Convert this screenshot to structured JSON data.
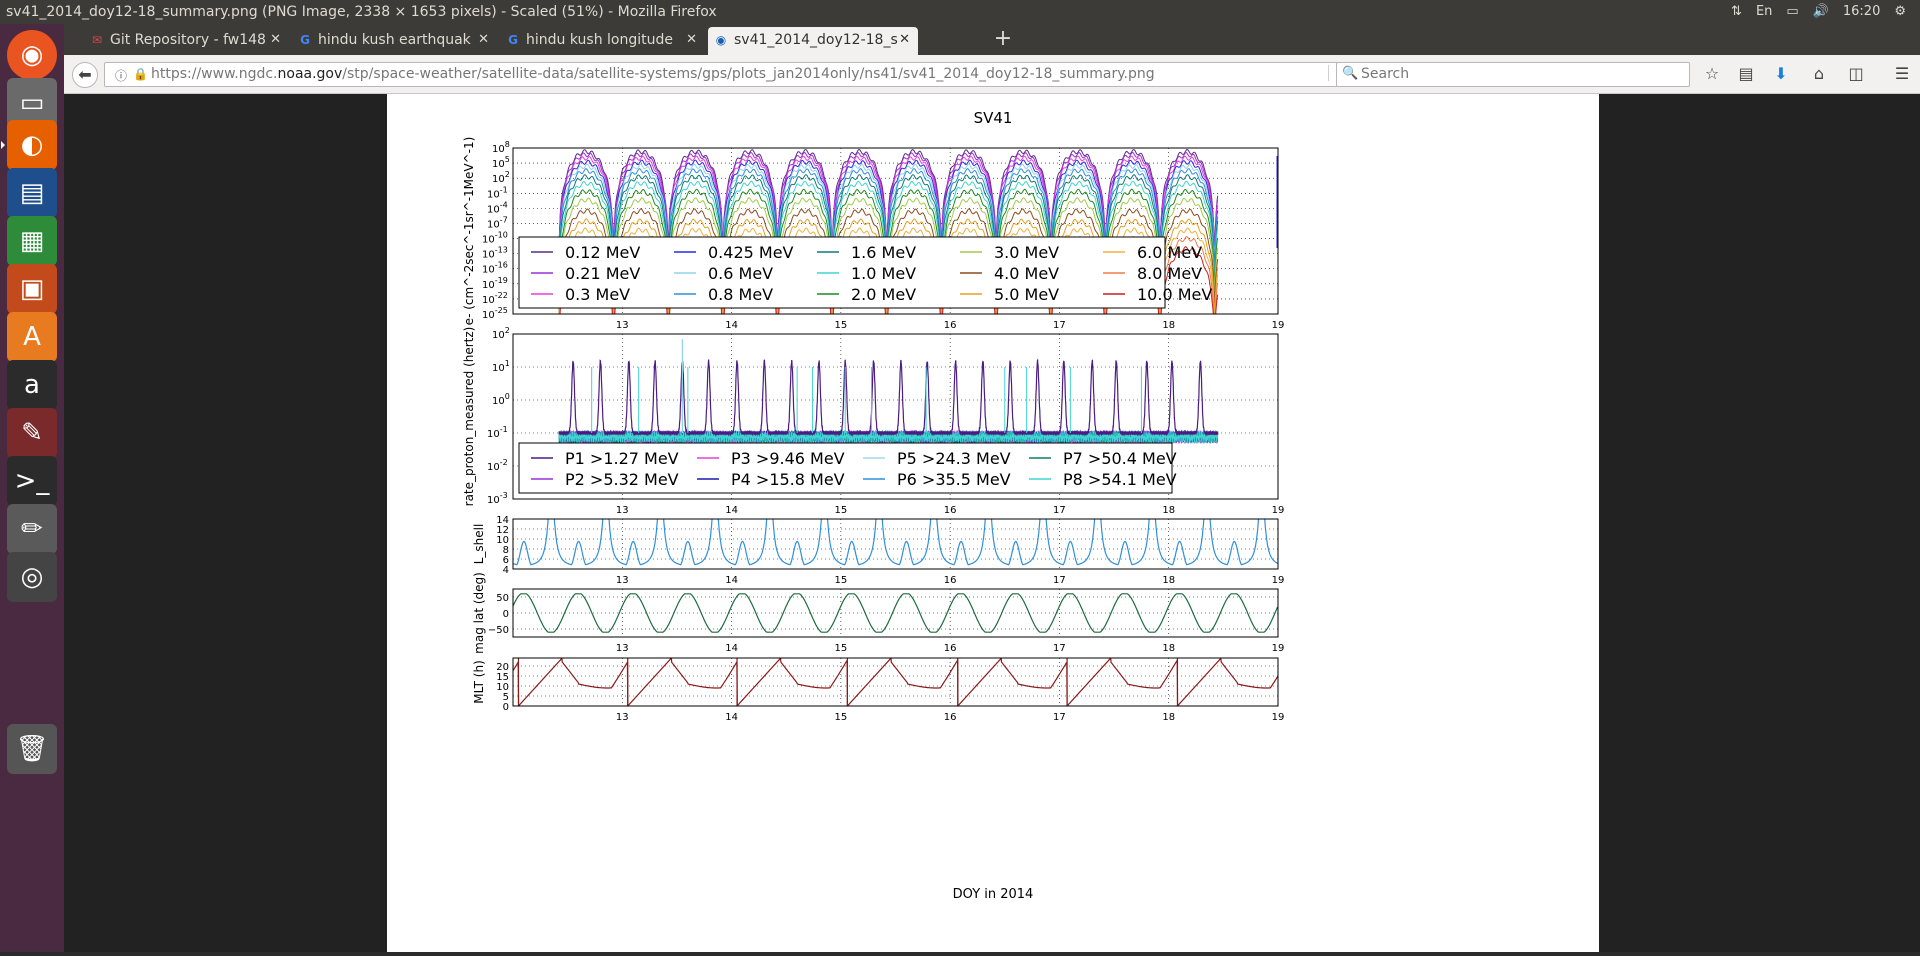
{
  "window": {
    "title": "sv41_2014_doy12-18_summary.png (PNG Image, 2338 × 1653 pixels) - Scaled (51%) - Mozilla Firefox",
    "tray_lang": "En",
    "clock": "16:20"
  },
  "tabs": [
    {
      "label": "Git Repository - fw148",
      "icon": "gmail-icon"
    },
    {
      "label": "hindu kush earthquak",
      "icon": "google-icon"
    },
    {
      "label": "hindu kush longitude",
      "icon": "google-icon"
    },
    {
      "label": "sv41_2014_doy12-18_s",
      "icon": "noaa-icon",
      "active": true
    }
  ],
  "navbar": {
    "url_prefix": "https://www.ngdc.",
    "url_domain": "noaa.gov",
    "url_path": "/stp/space-weather/satellite-data/satellite-systems/gps/plots_jan2014only/ns41/sv41_2014_doy12-18_summary.png",
    "search_placeholder": "Search"
  },
  "launcher": [
    "ubuntu-icon",
    "files-icon",
    "firefox-icon",
    "writer-icon",
    "calc-icon",
    "impress-icon",
    "software-center-icon",
    "amazon-icon",
    "settings-icon",
    "terminal-icon",
    "text-editor-icon",
    "dvd-icon",
    "trash-icon"
  ],
  "chart_data": {
    "title": "SV41",
    "xlabel": "DOY in 2014",
    "xlim": [
      12,
      19
    ],
    "xticks": [
      "13",
      "14",
      "15",
      "16",
      "17",
      "18",
      "19"
    ],
    "panels": [
      {
        "type": "line",
        "ylabel": "e- (cm^-2sec^-1sr^-1MeV^-1)",
        "ylim_log10": [
          -25,
          8
        ],
        "yticks": [
          "10^8",
          "10^5",
          "10^2",
          "10^-1",
          "10^-4",
          "10^-7",
          "10^-10",
          "10^-13",
          "10^-16",
          "10^-19",
          "10^-22",
          "10^-25"
        ],
        "legend": "lower-left",
        "series": [
          {
            "name": "0.12 MeV",
            "color": "#5b2c83"
          },
          {
            "name": "0.21 MeV",
            "color": "#9b30d9"
          },
          {
            "name": "0.3 MeV",
            "color": "#e83fd9"
          },
          {
            "name": "0.425 MeV",
            "color": "#2a2ae0"
          },
          {
            "name": "0.6 MeV",
            "color": "#8fd3ea"
          },
          {
            "name": "0.8 MeV",
            "color": "#2f8fdb"
          },
          {
            "name": "1.6 MeV",
            "color": "#127a72"
          },
          {
            "name": "1.0 MeV",
            "color": "#3fd3d3"
          },
          {
            "name": "2.0 MeV",
            "color": "#1e8a1e"
          },
          {
            "name": "3.0 MeV",
            "color": "#a3c94a"
          },
          {
            "name": "4.0 MeV",
            "color": "#8b4a1e"
          },
          {
            "name": "5.0 MeV",
            "color": "#e6a020"
          },
          {
            "name": "6.0 MeV",
            "color": "#f0b040"
          },
          {
            "name": "8.0 MeV",
            "color": "#f07a4a"
          },
          {
            "name": "10.0 MeV",
            "color": "#c81e1e"
          }
        ],
        "peak_log10": [
          7.3,
          6.7,
          6.0,
          5.2,
          4.4,
          3.5,
          2.3,
          1.0,
          -0.6,
          -2.3,
          -4.5,
          -6.5,
          -8.3,
          -10.0,
          -12.0
        ],
        "orbit_period_days": 0.5,
        "data_xrange": [
          12.42,
          18.45
        ]
      },
      {
        "type": "line",
        "ylabel": "rate_proton_measured (hertz)",
        "ylim_log10": [
          -3,
          2
        ],
        "yticks": [
          "10^2",
          "10^1",
          "10^0",
          "10^-1",
          "10^-2",
          "10^-3"
        ],
        "legend": "lower-left",
        "series": [
          {
            "name": "P1 >1.27 MeV",
            "color": "#4b1d82"
          },
          {
            "name": "P2 >5.32 MeV",
            "color": "#9b30d9"
          },
          {
            "name": "P3 >9.46 MeV",
            "color": "#e83fd9"
          },
          {
            "name": "P4 >15.8 MeV",
            "color": "#1a1ab0"
          },
          {
            "name": "P5 >24.3 MeV",
            "color": "#9fd8ea"
          },
          {
            "name": "P6 >35.5 MeV",
            "color": "#2f8fdb"
          },
          {
            "name": "P7 >50.4 MeV",
            "color": "#127a72"
          },
          {
            "name": "P8 >54.1 MeV",
            "color": "#3fd3d3"
          }
        ],
        "baseline": 0.1,
        "p1_peaks_doy": [
          12.55,
          12.8,
          13.06,
          13.3,
          13.55,
          13.79,
          14.05,
          14.3,
          14.55,
          14.8,
          15.04,
          15.3,
          15.55,
          15.79,
          16.05,
          16.3,
          16.55,
          16.8,
          17.04,
          17.3,
          17.52,
          17.8,
          18.03,
          18.29
        ],
        "p1_peak_value": 15,
        "spikes_doy": [
          12.72,
          13.15,
          13.55,
          13.6,
          14.6,
          14.74,
          15.04,
          15.28,
          15.78,
          16.5,
          16.7,
          17.1,
          17.75
        ],
        "spike_value": 10,
        "tall_spike": {
          "doy": 13.55,
          "value": 70
        },
        "data_xrange": [
          12.42,
          18.45
        ]
      },
      {
        "type": "line",
        "ylabel": "L_shell",
        "ylim": [
          4,
          14
        ],
        "yticks": [
          "14",
          "12",
          "10",
          "8",
          "6",
          "4"
        ],
        "color": "#2f8fdb",
        "minima": 4.3,
        "secondary_peak": 9.5,
        "period_days": 0.5
      },
      {
        "type": "line",
        "ylabel": "mag lat (deg)",
        "ylim": [
          -75,
          75
        ],
        "yticks": [
          "50",
          "0",
          "−50"
        ],
        "color": "#1e6b3e",
        "amplitude": 55,
        "period_days": 0.5
      },
      {
        "type": "line",
        "ylabel": "MLT (h)",
        "ylim": [
          0,
          24
        ],
        "yticks": [
          "20",
          "15",
          "10",
          "5",
          "0"
        ],
        "color": "#8b1a1a",
        "period_days": 1.0,
        "phase_wrap_doy": [
          12.05,
          13.05,
          14.05,
          15.06,
          16.07,
          17.07,
          18.08
        ]
      }
    ]
  }
}
